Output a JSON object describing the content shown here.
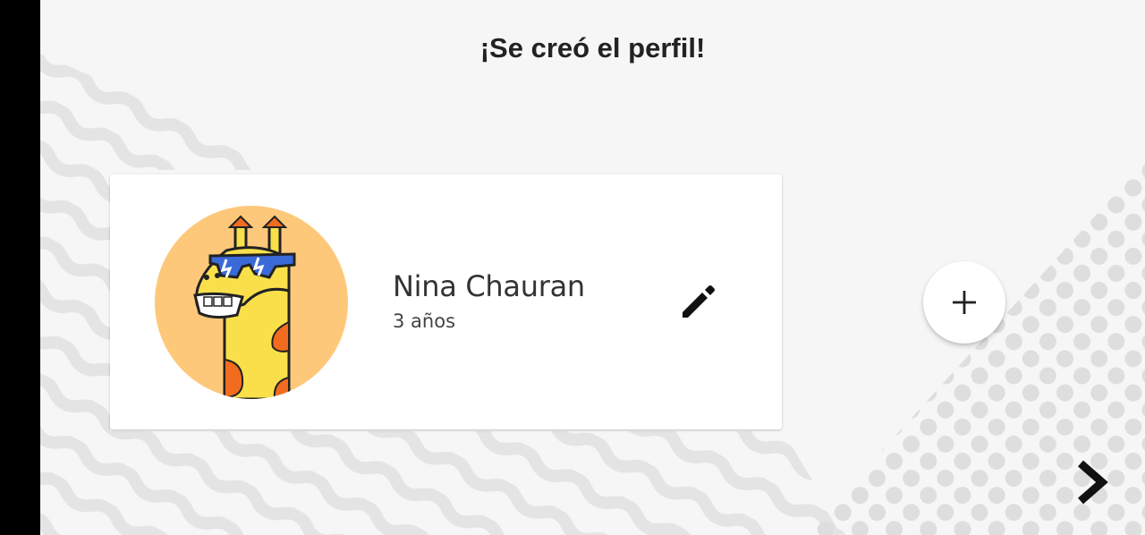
{
  "header": {
    "title": "¡Se creó el perfil!"
  },
  "profile_card": {
    "name": "Nina Chauran",
    "age": "3 años",
    "avatar": "giraffe-with-sunglasses"
  },
  "actions": {
    "edit_icon": "pencil-icon",
    "add_icon": "plus-icon",
    "next_icon": "chevron-right-icon"
  },
  "colors": {
    "background": "#f6f6f6",
    "pattern": "#e4e4e4",
    "avatar_bg": "#fec87a",
    "giraffe_body": "#f9e04b",
    "giraffe_spots": "#f26c1f",
    "sunglasses": "#3a69d8",
    "text_dark": "#222222"
  }
}
